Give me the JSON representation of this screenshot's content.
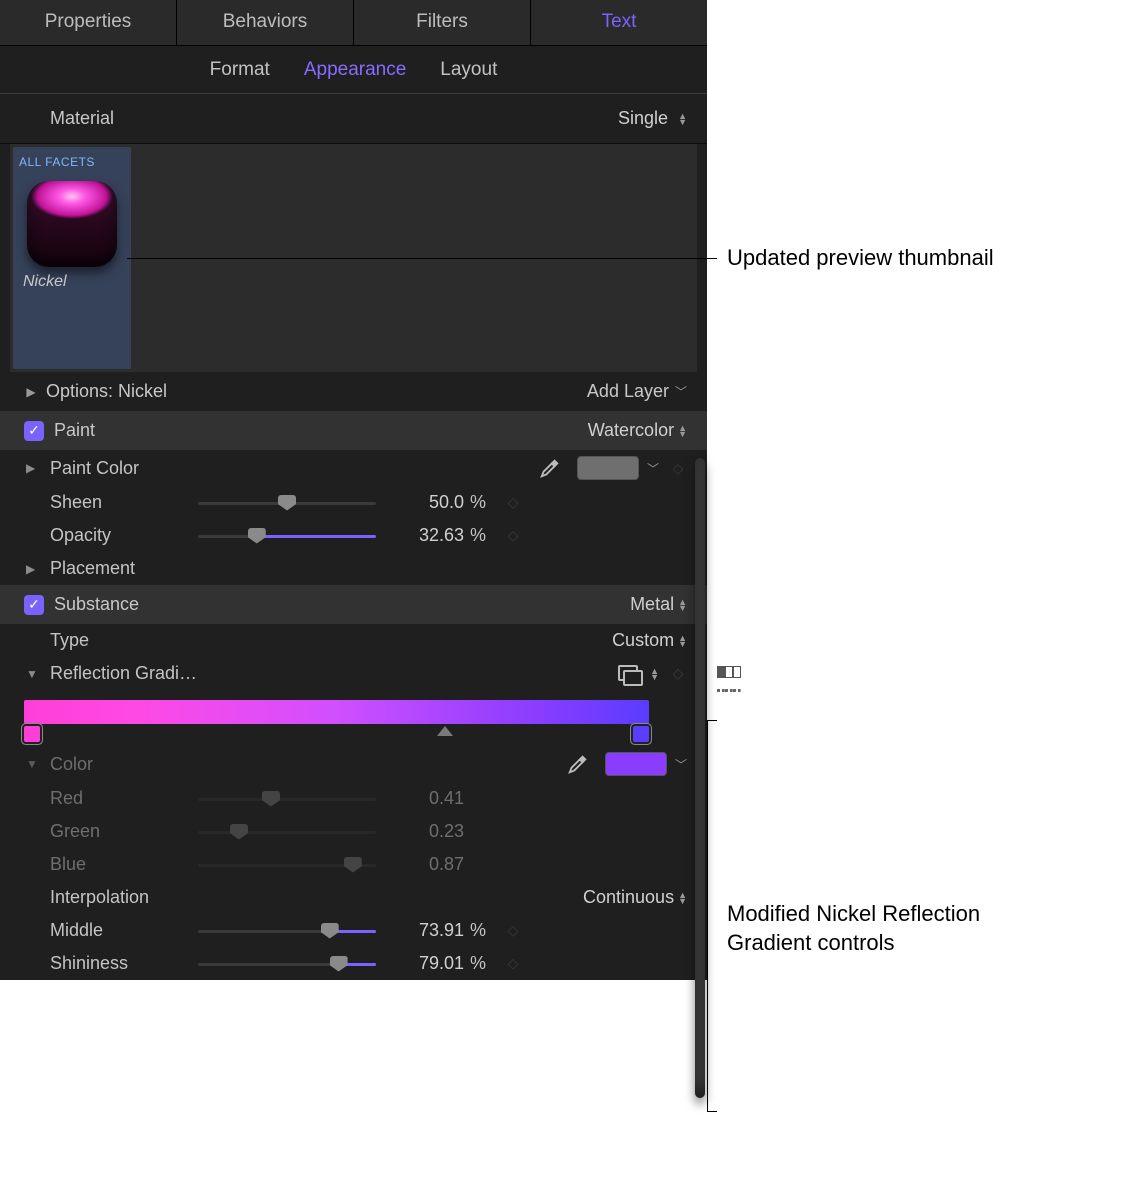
{
  "tabs": {
    "properties": "Properties",
    "behaviors": "Behaviors",
    "filters": "Filters",
    "text": "Text"
  },
  "subtabs": {
    "format": "Format",
    "appearance": "Appearance",
    "layout": "Layout"
  },
  "material": {
    "label": "Material",
    "value": "Single"
  },
  "preview": {
    "facets_title": "ALL FACETS",
    "material_name": "Nickel"
  },
  "options": {
    "label": "Options: Nickel",
    "add_layer": "Add Layer"
  },
  "paint": {
    "header": "Paint",
    "type": "Watercolor",
    "color_label": "Paint Color",
    "color_swatch": "#6f6f6f",
    "sheen_label": "Sheen",
    "sheen_value": "50.0",
    "sheen_unit": "%",
    "opacity_label": "Opacity",
    "opacity_value": "32.63",
    "opacity_unit": "%",
    "placement_label": "Placement"
  },
  "substance": {
    "header": "Substance",
    "value": "Metal",
    "type_label": "Type",
    "type_value": "Custom",
    "reflection_label": "Reflection Gradi…",
    "gradient_stops": {
      "left_color": "#ff3ed8",
      "right_color": "#5a3dff"
    },
    "color_label": "Color",
    "color_swatch": "#8a3dff",
    "red_label": "Red",
    "red_value": "0.41",
    "green_label": "Green",
    "green_value": "0.23",
    "blue_label": "Blue",
    "blue_value": "0.87",
    "interp_label": "Interpolation",
    "interp_value": "Continuous",
    "middle_label": "Middle",
    "middle_value": "73.91",
    "middle_unit": "%",
    "shininess_label": "Shininess",
    "shininess_value": "79.01",
    "shininess_unit": "%"
  },
  "callouts": {
    "preview": "Updated preview thumbnail",
    "gradient_l1": "Modified Nickel Reflection",
    "gradient_l2": "Gradient controls"
  },
  "chart_data": {
    "type": "table",
    "title": "Text Appearance – Material: Nickel (Custom Metal)",
    "rows": [
      {
        "group": "Paint",
        "param": "Type",
        "value": "Watercolor"
      },
      {
        "group": "Paint",
        "param": "Sheen",
        "value": 50.0,
        "unit": "%"
      },
      {
        "group": "Paint",
        "param": "Opacity",
        "value": 32.63,
        "unit": "%"
      },
      {
        "group": "Substance",
        "param": "Type",
        "value": "Custom"
      },
      {
        "group": "Substance/Color",
        "param": "Red",
        "value": 0.41
      },
      {
        "group": "Substance/Color",
        "param": "Green",
        "value": 0.23
      },
      {
        "group": "Substance/Color",
        "param": "Blue",
        "value": 0.87
      },
      {
        "group": "Substance",
        "param": "Interpolation",
        "value": "Continuous"
      },
      {
        "group": "Substance",
        "param": "Middle",
        "value": 73.91,
        "unit": "%"
      },
      {
        "group": "Substance",
        "param": "Shininess",
        "value": 79.01,
        "unit": "%"
      }
    ]
  }
}
